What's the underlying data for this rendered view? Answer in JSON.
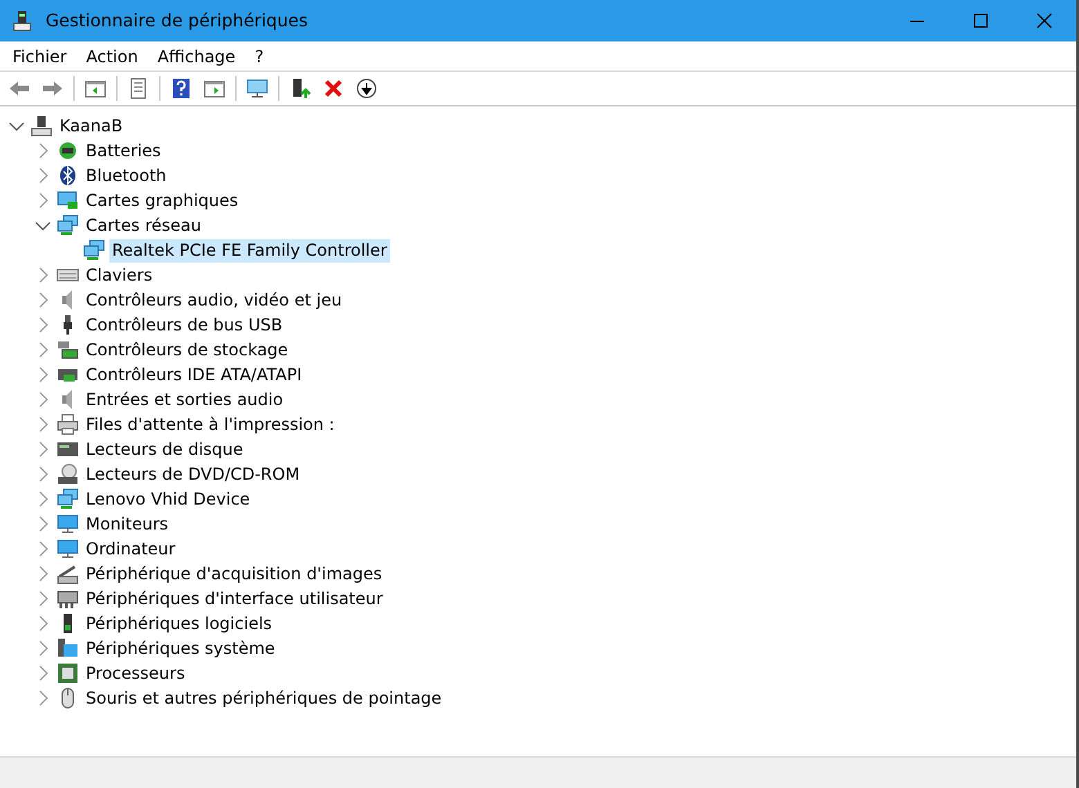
{
  "window": {
    "title": "Gestionnaire de périphériques"
  },
  "menu": [
    "Fichier",
    "Action",
    "Affichage",
    "?"
  ],
  "tree": [
    {
      "label": "KaanaB",
      "expanded": true,
      "selected": false,
      "children": [
        {
          "label": "Batteries",
          "expanded": false,
          "selected": false
        },
        {
          "label": "Bluetooth",
          "expanded": false,
          "selected": false
        },
        {
          "label": "Cartes graphiques",
          "expanded": false,
          "selected": false
        },
        {
          "label": "Cartes réseau",
          "expanded": true,
          "selected": false,
          "children": [
            {
              "label": "Realtek PCIe FE Family Controller",
              "selected": true
            }
          ]
        },
        {
          "label": "Claviers",
          "expanded": false,
          "selected": false
        },
        {
          "label": "Contrôleurs audio, vidéo et jeu",
          "expanded": false,
          "selected": false
        },
        {
          "label": "Contrôleurs de bus USB",
          "expanded": false,
          "selected": false
        },
        {
          "label": "Contrôleurs de stockage",
          "expanded": false,
          "selected": false
        },
        {
          "label": "Contrôleurs IDE ATA/ATAPI",
          "expanded": false,
          "selected": false
        },
        {
          "label": "Entrées et sorties audio",
          "expanded": false,
          "selected": false
        },
        {
          "label": "Files d'attente à l'impression :",
          "expanded": false,
          "selected": false
        },
        {
          "label": "Lecteurs de disque",
          "expanded": false,
          "selected": false
        },
        {
          "label": "Lecteurs de DVD/CD-ROM",
          "expanded": false,
          "selected": false
        },
        {
          "label": "Lenovo Vhid Device",
          "expanded": false,
          "selected": false
        },
        {
          "label": "Moniteurs",
          "expanded": false,
          "selected": false
        },
        {
          "label": "Ordinateur",
          "expanded": false,
          "selected": false
        },
        {
          "label": "Périphérique d'acquisition d'images",
          "expanded": false,
          "selected": false
        },
        {
          "label": "Périphériques d'interface utilisateur",
          "expanded": false,
          "selected": false
        },
        {
          "label": "Périphériques logiciels",
          "expanded": false,
          "selected": false
        },
        {
          "label": "Périphériques système",
          "expanded": false,
          "selected": false
        },
        {
          "label": "Processeurs",
          "expanded": false,
          "selected": false
        },
        {
          "label": "Souris et autres périphériques de pointage",
          "expanded": false,
          "selected": false
        }
      ]
    }
  ]
}
